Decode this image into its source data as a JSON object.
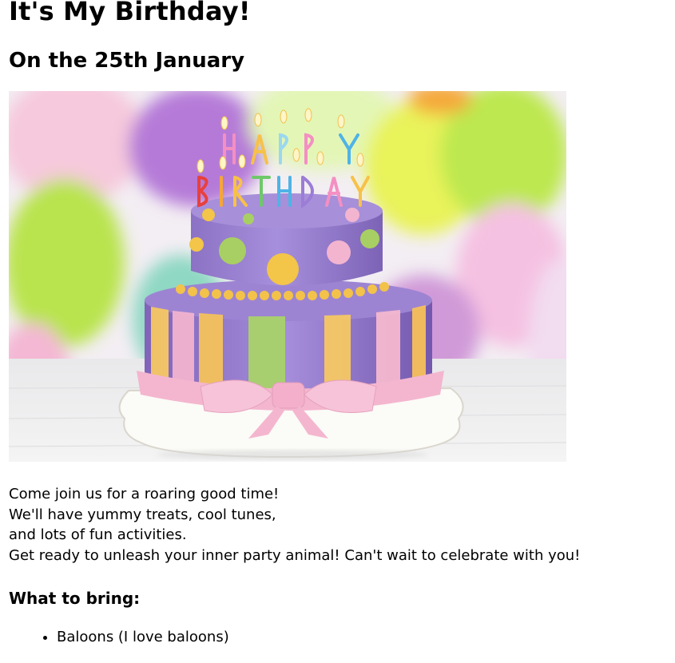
{
  "header": {
    "title": "It's My Birthday!",
    "subtitle": "On the 25th January"
  },
  "hero_image": {
    "candle_letters_top": "HAPPY",
    "candle_letters_bottom": "BIRTHDAY"
  },
  "intro": {
    "lines": [
      "Come join us for a roaring good time!",
      "We'll have yummy treats, cool tunes,",
      "and lots of fun activities.",
      "Get ready to unleash your inner party animal! Can't wait to celebrate with you!"
    ]
  },
  "bring": {
    "heading": "What to bring:",
    "items": [
      "Baloons (I love baloons)"
    ]
  }
}
